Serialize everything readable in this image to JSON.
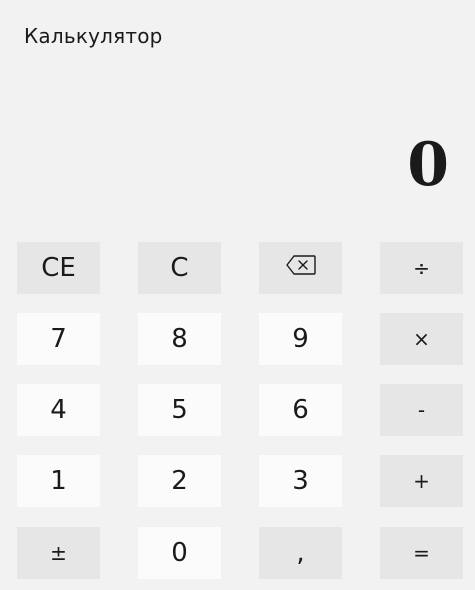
{
  "app": {
    "title": "Калькулятор"
  },
  "display": {
    "value": "0"
  },
  "keys": {
    "ce": "CE",
    "c": "C",
    "divide": "÷",
    "seven": "7",
    "eight": "8",
    "nine": "9",
    "multiply": "×",
    "four": "4",
    "five": "5",
    "six": "6",
    "minus": "-",
    "one": "1",
    "two": "2",
    "three": "3",
    "plus": "+",
    "plus_minus": "±",
    "zero": "0",
    "decimal": ",",
    "equals": "="
  },
  "icons": {
    "backspace": "backspace-icon"
  },
  "colors": {
    "background": "#f2f2f2",
    "key_light": "#fbfbfb",
    "key_dark": "#e6e6e6",
    "text": "#1a1a1a"
  }
}
